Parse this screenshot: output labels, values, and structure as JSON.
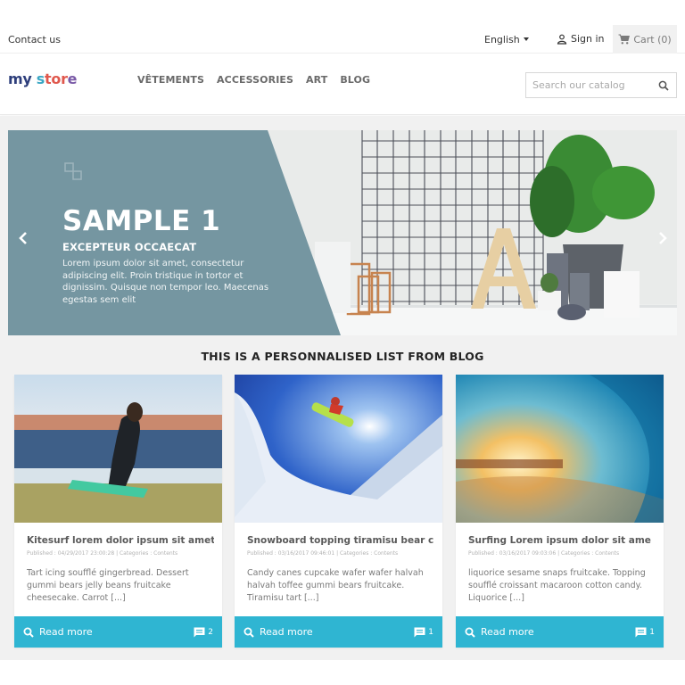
{
  "topnav": {
    "contact_label": "Contact us",
    "language": "English",
    "signin_label": "Sign in",
    "cart_label": "Cart (0)"
  },
  "header": {
    "logo": {
      "part1": "my",
      "part2": "s",
      "part3": "tor",
      "part4": "e"
    },
    "menu": [
      "VÊTEMENTS",
      "ACCESSORIES",
      "ART",
      "BLOG"
    ],
    "search": {
      "placeholder": "Search our catalog",
      "value": ""
    }
  },
  "slider": {
    "title": "SAMPLE 1",
    "subtitle": "EXCEPTEUR OCCAECAT",
    "description": "Lorem ipsum dolor sit amet, consectetur adipiscing elit. Proin tristique in tortor et dignissim. Quisque non tempor leo. Maecenas egestas sem elit",
    "panel_color": "#7596a1"
  },
  "blog": {
    "heading": "THIS IS A PERSONNALISED LIST FROM BLOG",
    "accent_color": "#2fb5d2",
    "posts": [
      {
        "title": "Kitesurf lorem dolor ipsum sit amet",
        "meta": "Published : 04/29/2017 23:00:28 | Categories : Contents",
        "excerpt": "Tart icing soufflé gingerbread. Dessert gummi bears jelly beans fruitcake cheesecake. Carrot [...]",
        "read_more": "Read more",
        "comments": "2",
        "image": "kitesurf-photo"
      },
      {
        "title": "Snowboard topping tiramisu bear cla",
        "meta": "Published : 03/16/2017 09:46:01 | Categories : Contents",
        "excerpt": "Candy canes cupcake wafer wafer halvah halvah toffee gummi bears fruitcake. Tiramisu tart [...]",
        "read_more": "Read more",
        "comments": "1",
        "image": "snowboard-photo"
      },
      {
        "title": "Surfing Lorem ipsum dolor sit ame",
        "meta": "Published : 03/16/2017 09:03:06 | Categories : Contents",
        "excerpt": "liquorice sesame snaps fruitcake. Topping soufflé croissant macaroon cotton candy. Liquorice [...]",
        "read_more": "Read more",
        "comments": "1",
        "image": "surfing-photo"
      }
    ]
  }
}
